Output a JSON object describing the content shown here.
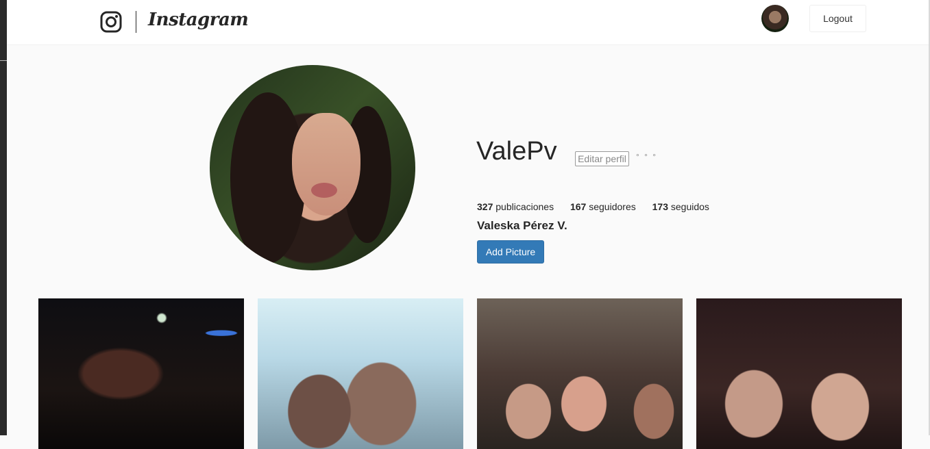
{
  "navbar": {
    "brand": "Instagram",
    "logout_label": "Logout"
  },
  "profile": {
    "username": "ValePv",
    "edit_label": "Editar perfil",
    "options_glyph": "° ° °",
    "stats": [
      {
        "count": "327",
        "label": "publicaciones"
      },
      {
        "count": "167",
        "label": "seguidores"
      },
      {
        "count": "173",
        "label": "seguidos"
      }
    ],
    "full_name": "Valeska Pérez V.",
    "add_picture_label": "Add Picture"
  },
  "colors": {
    "primary_button": "#337ab7",
    "background": "#fafafa"
  }
}
